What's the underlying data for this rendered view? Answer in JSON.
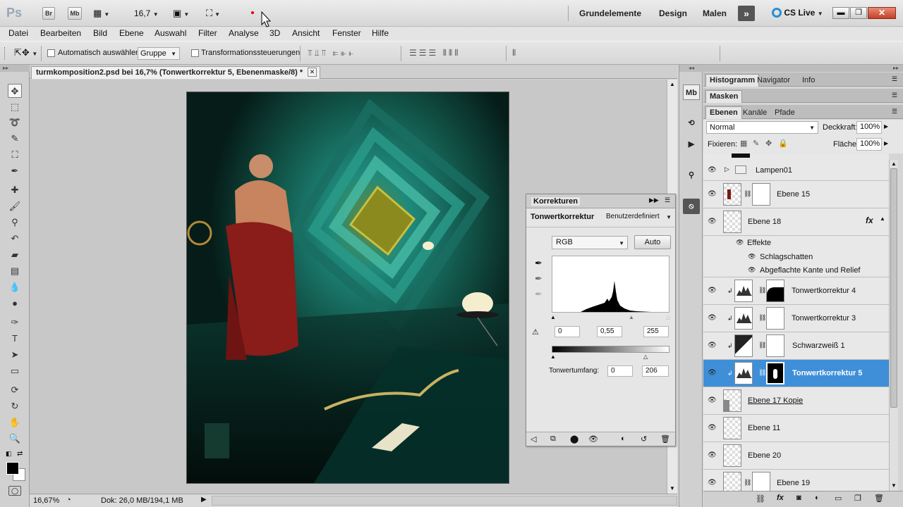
{
  "app": {
    "logo": "Ps",
    "bridge": "Br",
    "minibridge": "Mb",
    "zoom_select": "16,7",
    "cs_live": "CS Live"
  },
  "workspaces": [
    "Grundelemente",
    "Design",
    "Malen"
  ],
  "menu": [
    "Datei",
    "Bearbeiten",
    "Bild",
    "Ebene",
    "Auswahl",
    "Filter",
    "Analyse",
    "3D",
    "Ansicht",
    "Fenster",
    "Hilfe"
  ],
  "options": {
    "auto_select_label": "Automatisch auswählen:",
    "auto_select_value": "Gruppe",
    "transform_label": "Transformationssteuerungen"
  },
  "document": {
    "tab_title": "turmkomposition2.psd bei 16,7% (Tonwertkorrektur 5, Ebenenmaske/8) *"
  },
  "status": {
    "zoom": "16,67%",
    "doc_size": "Dok: 26,0 MB/194,1 MB"
  },
  "korrekturen": {
    "panel_title": "Korrekturen",
    "adjustment": "Tonwertkorrektur",
    "preset": "Benutzerdefiniert",
    "channel": "RGB",
    "auto_button": "Auto",
    "input_black": "0",
    "input_gamma": "0,55",
    "input_white": "255",
    "output_label": "Tonwertumfang:",
    "output_black": "0",
    "output_white": "206"
  },
  "panels": {
    "top_tabs": [
      "Histogramm",
      "Navigator",
      "Info"
    ],
    "masks_tab": "Masken",
    "layer_tabs": [
      "Ebenen",
      "Kanäle",
      "Pfade"
    ],
    "blend_mode": "Normal",
    "opacity_label": "Deckkraft:",
    "opacity_value": "100%",
    "lock_label": "Fixieren:",
    "fill_label": "Fläche:",
    "fill_value": "100%"
  },
  "layers": [
    {
      "name": "Lampen01",
      "kind": "group"
    },
    {
      "name": "Ebene 15",
      "kind": "mask-layer"
    },
    {
      "name": "Ebene 18",
      "kind": "fx-layer"
    },
    {
      "name": "Effekte",
      "kind": "effects-header"
    },
    {
      "name": "Schlagschatten",
      "kind": "effect"
    },
    {
      "name": "Abgeflachte Kante und Relief",
      "kind": "effect"
    },
    {
      "name": "Tonwertkorrektur 4",
      "kind": "adjustment"
    },
    {
      "name": "Tonwertkorrektur 3",
      "kind": "adjustment"
    },
    {
      "name": "Schwarzweiß 1",
      "kind": "adjustment"
    },
    {
      "name": "Tonwertkorrektur 5",
      "kind": "adjustment",
      "selected": true
    },
    {
      "name": "Ebene 17 Kopie",
      "kind": "layer"
    },
    {
      "name": "Ebene 11",
      "kind": "layer"
    },
    {
      "name": "Ebene 20",
      "kind": "layer"
    },
    {
      "name": "Ebene 19",
      "kind": "mask-layer"
    }
  ],
  "colors": {
    "selection": "#3f8fd8",
    "canvas_bg": "#c8c8c8"
  }
}
